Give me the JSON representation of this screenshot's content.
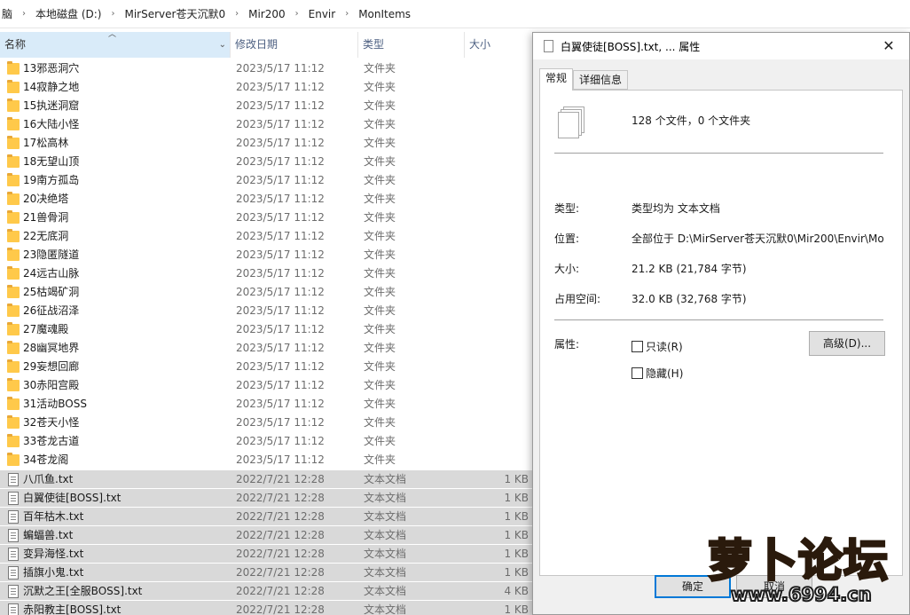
{
  "breadcrumb": [
    "脑",
    "本地磁盘 (D:)",
    "MirServer苍天沉默0",
    "Mir200",
    "Envir",
    "MonItems"
  ],
  "columns": {
    "name": "名称",
    "date": "修改日期",
    "type": "类型",
    "size": "大小"
  },
  "files": [
    {
      "name": "13邪恶洞穴",
      "date": "2023/5/17 11:12",
      "type": "文件夹",
      "size": "",
      "kind": "folder",
      "selected": false
    },
    {
      "name": "14寂静之地",
      "date": "2023/5/17 11:12",
      "type": "文件夹",
      "size": "",
      "kind": "folder",
      "selected": false
    },
    {
      "name": "15执迷洞窟",
      "date": "2023/5/17 11:12",
      "type": "文件夹",
      "size": "",
      "kind": "folder",
      "selected": false
    },
    {
      "name": "16大陆小怪",
      "date": "2023/5/17 11:12",
      "type": "文件夹",
      "size": "",
      "kind": "folder",
      "selected": false
    },
    {
      "name": "17松高林",
      "date": "2023/5/17 11:12",
      "type": "文件夹",
      "size": "",
      "kind": "folder",
      "selected": false
    },
    {
      "name": "18无望山顶",
      "date": "2023/5/17 11:12",
      "type": "文件夹",
      "size": "",
      "kind": "folder",
      "selected": false
    },
    {
      "name": "19南方孤岛",
      "date": "2023/5/17 11:12",
      "type": "文件夹",
      "size": "",
      "kind": "folder",
      "selected": false
    },
    {
      "name": "20决绝塔",
      "date": "2023/5/17 11:12",
      "type": "文件夹",
      "size": "",
      "kind": "folder",
      "selected": false
    },
    {
      "name": "21兽骨洞",
      "date": "2023/5/17 11:12",
      "type": "文件夹",
      "size": "",
      "kind": "folder",
      "selected": false
    },
    {
      "name": "22无底洞",
      "date": "2023/5/17 11:12",
      "type": "文件夹",
      "size": "",
      "kind": "folder",
      "selected": false
    },
    {
      "name": "23隐匿隧道",
      "date": "2023/5/17 11:12",
      "type": "文件夹",
      "size": "",
      "kind": "folder",
      "selected": false
    },
    {
      "name": "24远古山脉",
      "date": "2023/5/17 11:12",
      "type": "文件夹",
      "size": "",
      "kind": "folder",
      "selected": false
    },
    {
      "name": "25枯竭矿洞",
      "date": "2023/5/17 11:12",
      "type": "文件夹",
      "size": "",
      "kind": "folder",
      "selected": false
    },
    {
      "name": "26征战沼泽",
      "date": "2023/5/17 11:12",
      "type": "文件夹",
      "size": "",
      "kind": "folder",
      "selected": false
    },
    {
      "name": "27魔魂殿",
      "date": "2023/5/17 11:12",
      "type": "文件夹",
      "size": "",
      "kind": "folder",
      "selected": false
    },
    {
      "name": "28幽冥地界",
      "date": "2023/5/17 11:12",
      "type": "文件夹",
      "size": "",
      "kind": "folder",
      "selected": false
    },
    {
      "name": "29妄想回廊",
      "date": "2023/5/17 11:12",
      "type": "文件夹",
      "size": "",
      "kind": "folder",
      "selected": false
    },
    {
      "name": "30赤阳宫殿",
      "date": "2023/5/17 11:12",
      "type": "文件夹",
      "size": "",
      "kind": "folder",
      "selected": false
    },
    {
      "name": "31活动BOSS",
      "date": "2023/5/17 11:12",
      "type": "文件夹",
      "size": "",
      "kind": "folder",
      "selected": false
    },
    {
      "name": "32苍天小怪",
      "date": "2023/5/17 11:12",
      "type": "文件夹",
      "size": "",
      "kind": "folder",
      "selected": false
    },
    {
      "name": "33苍龙古道",
      "date": "2023/5/17 11:12",
      "type": "文件夹",
      "size": "",
      "kind": "folder",
      "selected": false
    },
    {
      "name": "34苍龙阁",
      "date": "2023/5/17 11:12",
      "type": "文件夹",
      "size": "",
      "kind": "folder",
      "selected": false
    },
    {
      "name": "八爪鱼.txt",
      "date": "2022/7/21 12:28",
      "type": "文本文档",
      "size": "1 KB",
      "kind": "file",
      "selected": true
    },
    {
      "name": "白翼使徒[BOSS].txt",
      "date": "2022/7/21 12:28",
      "type": "文本文档",
      "size": "1 KB",
      "kind": "file",
      "selected": true
    },
    {
      "name": "百年枯木.txt",
      "date": "2022/7/21 12:28",
      "type": "文本文档",
      "size": "1 KB",
      "kind": "file",
      "selected": true
    },
    {
      "name": "蝙蝠兽.txt",
      "date": "2022/7/21 12:28",
      "type": "文本文档",
      "size": "1 KB",
      "kind": "file",
      "selected": true
    },
    {
      "name": "变异海怪.txt",
      "date": "2022/7/21 12:28",
      "type": "文本文档",
      "size": "1 KB",
      "kind": "file",
      "selected": true
    },
    {
      "name": "插旗小鬼.txt",
      "date": "2022/7/21 12:28",
      "type": "文本文档",
      "size": "1 KB",
      "kind": "file",
      "selected": true
    },
    {
      "name": "沉默之王[全服BOSS].txt",
      "date": "2022/7/21 12:28",
      "type": "文本文档",
      "size": "4 KB",
      "kind": "file",
      "selected": true
    },
    {
      "name": "赤阳教主[BOSS].txt",
      "date": "2022/7/21 12:28",
      "type": "文本文档",
      "size": "1 KB",
      "kind": "file",
      "selected": true
    }
  ],
  "dialog": {
    "title": "白翼使徒[BOSS].txt, ... 属性",
    "tabs": [
      "常规",
      "详细信息"
    ],
    "summary": "128 个文件，0 个文件夹",
    "type_label": "类型:",
    "type_value": "类型均为 文本文档",
    "location_label": "位置:",
    "location_value": "全部位于 D:\\MirServer苍天沉默0\\Mir200\\Envir\\Mo",
    "size_label": "大小:",
    "size_value": "21.2 KB (21,784 字节)",
    "disk_label": "占用空间:",
    "disk_value": "32.0 KB (32,768 字节)",
    "attr_label": "属性:",
    "readonly_label": "只读(R)",
    "hidden_label": "隐藏(H)",
    "advanced_button": "高级(D)...",
    "ok_button": "确定",
    "cancel_button": "取消"
  },
  "watermark": {
    "title": "萝卜论坛",
    "url": "www.6994.cn"
  },
  "colors": {
    "header_active": "#d9ebf9",
    "selected_row": "#d9d9d9",
    "folder": "#ffc94a",
    "accent": "#0078d7"
  }
}
